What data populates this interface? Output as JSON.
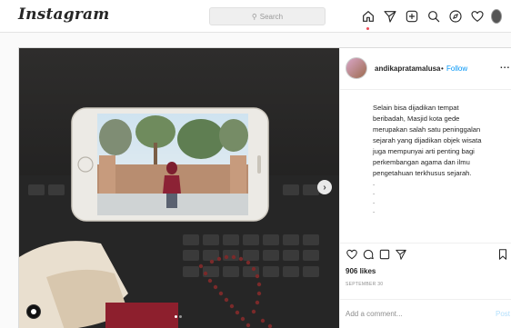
{
  "header": {
    "logo": "Instagram",
    "search_placeholder": "Search",
    "icons": [
      "home-icon",
      "direct-icon",
      "new-post-icon",
      "search-icon",
      "explore-icon",
      "heart-icon",
      "profile-avatar"
    ]
  },
  "post": {
    "username": "andikapratamalusa",
    "separator": "•",
    "follow_label": "Follow",
    "more_label": "...",
    "caption_lines": [
      "Selain bisa dijadikan tempat",
      "beribadah, Masjid kota gede",
      "merupakan salah satu peninggalan",
      "sejarah yang dijadikan objek wisata",
      "juga mempunyai arti penting bagi",
      "perkembangan agama dan ilmu",
      "pengetahuan terkhusus sejarah."
    ],
    "caption_dots": [
      ".",
      ".",
      ".",
      "."
    ],
    "likes": "906 likes",
    "date": "SEPTEMBER 30",
    "comment_placeholder": "Add a comment...",
    "post_button": "Post",
    "carousel_next": "›",
    "carousel_count": 2,
    "carousel_active": 1
  },
  "colors": {
    "accent": "#0095f6",
    "notification": "#ed4956",
    "post_disabled": "#b2dffc"
  }
}
